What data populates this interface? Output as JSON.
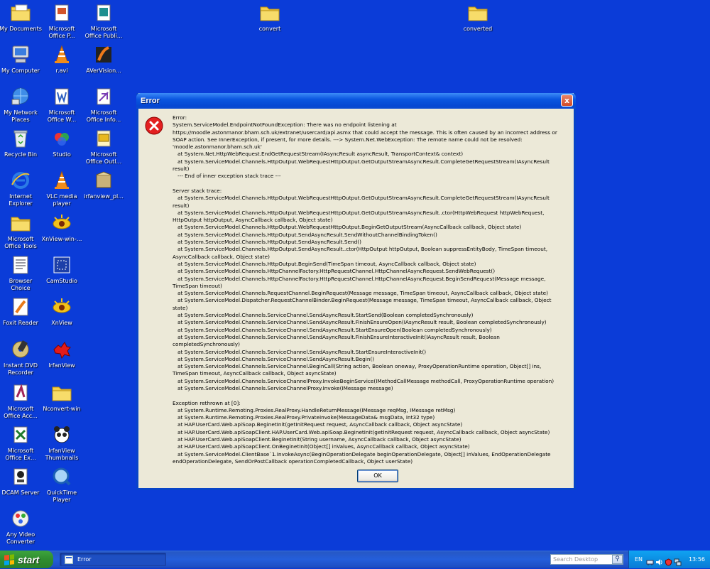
{
  "desktop": {
    "icons": [
      {
        "label": "My Documents"
      },
      {
        "label": "My Computer"
      },
      {
        "label": "My Network Places"
      },
      {
        "label": "Recycle Bin"
      },
      {
        "label": "Internet Explorer"
      },
      {
        "label": "Microsoft Office Tools"
      },
      {
        "label": "Browser Choice"
      },
      {
        "label": "Foxit Reader"
      },
      {
        "label": "Instant DVD Recorder"
      },
      {
        "label": "Microsoft Office Acc..."
      },
      {
        "label": "Microsoft Office Ex..."
      },
      {
        "label": "DCAM Server"
      },
      {
        "label": "Any Video Converter"
      },
      {
        "label": "Microsoft Office P..."
      },
      {
        "label": "r.avi"
      },
      {
        "label": "Microsoft Office W..."
      },
      {
        "label": "Studio"
      },
      {
        "label": "VLC media player"
      },
      {
        "label": "XnView-win-..."
      },
      {
        "label": "CamStudio"
      },
      {
        "label": "XnView"
      },
      {
        "label": "IrfanView"
      },
      {
        "label": "Nconvert-win"
      },
      {
        "label": "IrfanView Thumbnails"
      },
      {
        "label": "QuickTime Player"
      },
      {
        "label": "Microsoft Office Publi..."
      },
      {
        "label": "AVerVision..."
      },
      {
        "label": "Microsoft Office Info..."
      },
      {
        "label": "Microsoft Office Outl..."
      },
      {
        "label": "irfanview_pl..."
      },
      {
        "label": "convert"
      },
      {
        "label": "converted"
      }
    ]
  },
  "dialog": {
    "title": "Error",
    "close_label": "x",
    "message": "Error:\nSystem.ServiceModel.EndpointNotFoundException: There was no endpoint listening at\nhttps://moodle.astonmanor.bham.sch.uk/extranet/usercard/api.asmx that could accept the message. This is often caused by an incorrect address or\nSOAP action. See InnerException, if present, for more details. ---> System.Net.WebException: The remote name could not be resolved:\n'moodle.astonmanor.bham.sch.uk'\n   at System.Net.HttpWebRequest.EndGetRequestStream(IAsyncResult asyncResult, TransportContext& context)\n   at System.ServiceModel.Channels.HttpOutput.WebRequestHttpOutput.GetOutputStreamAsyncResult.CompleteGetRequestStream(IAsyncResult\nresult)\n   --- End of inner exception stack trace ---\n\nServer stack trace:\n   at System.ServiceModel.Channels.HttpOutput.WebRequestHttpOutput.GetOutputStreamAsyncResult.CompleteGetRequestStream(IAsyncResult\nresult)\n   at System.ServiceModel.Channels.HttpOutput.WebRequestHttpOutput.GetOutputStreamAsyncResult..ctor(HttpWebRequest httpWebRequest,\nHttpOutput httpOutput, AsyncCallback callback, Object state)\n   at System.ServiceModel.Channels.HttpOutput.WebRequestHttpOutput.BeginGetOutputStream(AsyncCallback callback, Object state)\n   at System.ServiceModel.Channels.HttpOutput.SendAsyncResult.SendWithoutChannelBindingToken()\n   at System.ServiceModel.Channels.HttpOutput.SendAsyncResult.Send()\n   at System.ServiceModel.Channels.HttpOutput.SendAsyncResult..ctor(HttpOutput httpOutput, Boolean suppressEntityBody, TimeSpan timeout,\nAsyncCallback callback, Object state)\n   at System.ServiceModel.Channels.HttpOutput.BeginSend(TimeSpan timeout, AsyncCallback callback, Object state)\n   at System.ServiceModel.Channels.HttpChannelFactory.HttpRequestChannel.HttpChannelAsyncRequest.SendWebRequest()\n   at System.ServiceModel.Channels.HttpChannelFactory.HttpRequestChannel.HttpChannelAsyncRequest.BeginSendRequest(Message message,\nTimeSpan timeout)\n   at System.ServiceModel.Channels.RequestChannel.BeginRequest(Message message, TimeSpan timeout, AsyncCallback callback, Object state)\n   at System.ServiceModel.Dispatcher.RequestChannelBinder.BeginRequest(Message message, TimeSpan timeout, AsyncCallback callback, Object\nstate)\n   at System.ServiceModel.Channels.ServiceChannel.SendAsyncResult.StartSend(Boolean completedSynchronously)\n   at System.ServiceModel.Channels.ServiceChannel.SendAsyncResult.FinishEnsureOpen(IAsyncResult result, Boolean completedSynchronously)\n   at System.ServiceModel.Channels.ServiceChannel.SendAsyncResult.StartEnsureOpen(Boolean completedSynchronously)\n   at System.ServiceModel.Channels.ServiceChannel.SendAsyncResult.FinishEnsureInteractiveInit(IAsyncResult result, Boolean\ncompletedSynchronously)\n   at System.ServiceModel.Channels.ServiceChannel.SendAsyncResult.StartEnsureInteractiveInit()\n   at System.ServiceModel.Channels.ServiceChannel.SendAsyncResult.Begin()\n   at System.ServiceModel.Channels.ServiceChannel.BeginCall(String action, Boolean oneway, ProxyOperationRuntime operation, Object[] ins,\nTimeSpan timeout, AsyncCallback callback, Object asyncState)\n   at System.ServiceModel.Channels.ServiceChannelProxy.InvokeBeginService(IMethodCallMessage methodCall, ProxyOperationRuntime operation)\n   at System.ServiceModel.Channels.ServiceChannelProxy.Invoke(IMessage message)\n\nException rethrown at [0]:\n   at System.Runtime.Remoting.Proxies.RealProxy.HandleReturnMessage(IMessage reqMsg, IMessage retMsg)\n   at System.Runtime.Remoting.Proxies.RealProxy.PrivateInvoke(MessageData& msgData, Int32 type)\n   at HAP.UserCard.Web.apiSoap.BeginetInit(getInitRequest request, AsyncCallback callback, Object asyncState)\n   at HAP.UserCard.Web.apiSoapClient.HAP.UserCard.Web.apiSoap.BeginetInit(getInitRequest request, AsyncCallback callback, Object asyncState)\n   at HAP.UserCard.Web.apiSoapClient.BeginetInit(String username, AsyncCallback callback, Object asyncState)\n   at HAP.UserCard.Web.apiSoapClient.OnBeginetInit(Object[] inValues, AsyncCallback callback, Object asyncState)\n   at System.ServiceModel.ClientBase`1.InvokeAsync(BeginOperationDelegate beginOperationDelegate, Object[] inValues, EndOperationDelegate\nendOperationDelegate, SendOrPostCallback operationCompletedCallback, Object userState)",
    "ok_label": "OK"
  },
  "taskbar": {
    "start_label": "start",
    "task_label": "Error",
    "search_placeholder": "Search Desktop",
    "language": "EN",
    "clock": "13:56"
  }
}
